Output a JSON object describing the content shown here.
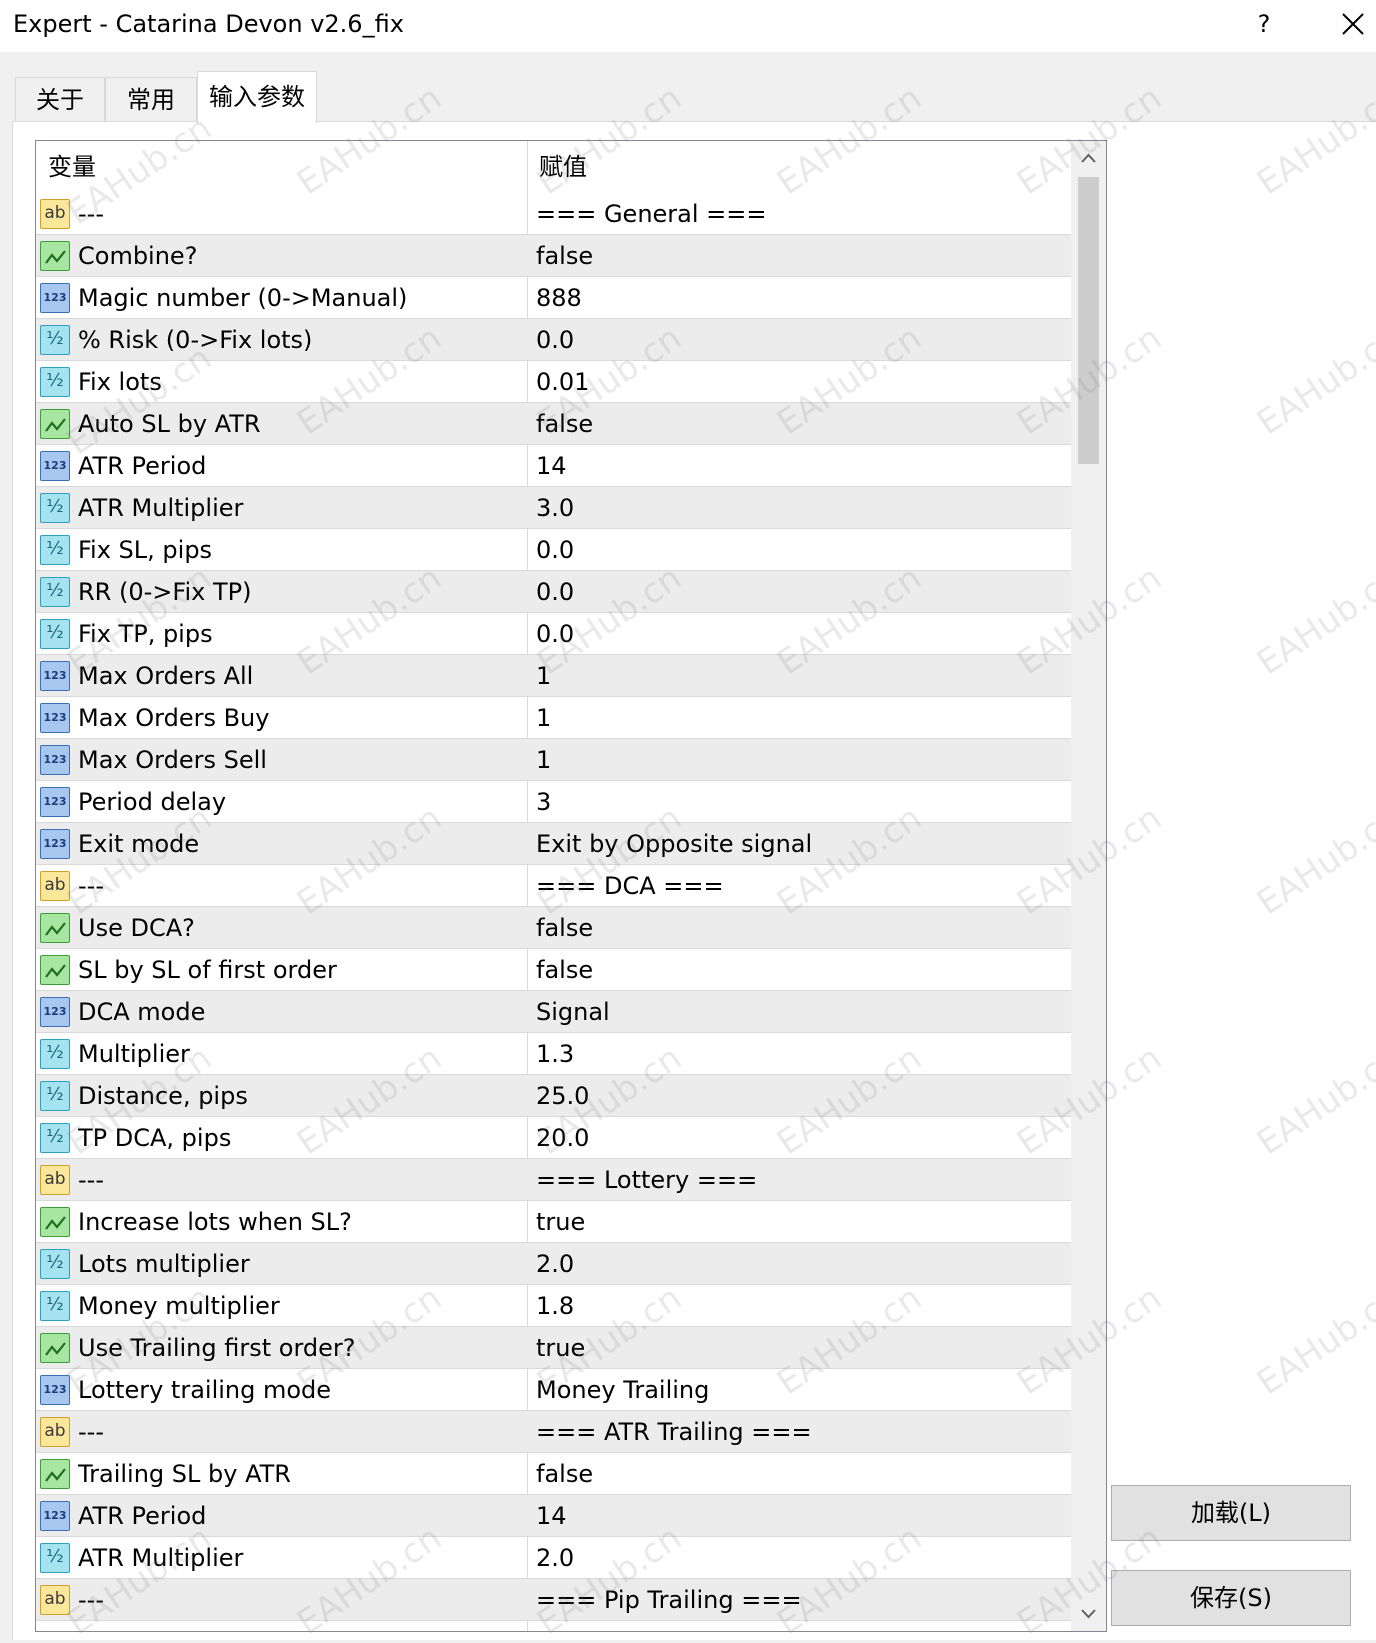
{
  "window": {
    "title": "Expert - Catarina Devon v2.6_fix",
    "help_label": "?"
  },
  "tabs": [
    {
      "label": "关于"
    },
    {
      "label": "常用"
    },
    {
      "label": "输入参数"
    }
  ],
  "grid": {
    "col_variable": "变量",
    "col_value": "赋值",
    "rows": [
      {
        "type": "string",
        "name": "---",
        "value": "=== General ==="
      },
      {
        "type": "bool",
        "name": "Combine?",
        "value": "false"
      },
      {
        "type": "int",
        "name": "Magic number (0->Manual)",
        "value": "888"
      },
      {
        "type": "double",
        "name": "% Risk (0->Fix lots)",
        "value": "0.0"
      },
      {
        "type": "double",
        "name": "Fix lots",
        "value": "0.01"
      },
      {
        "type": "bool",
        "name": "Auto SL by ATR",
        "value": "false"
      },
      {
        "type": "int",
        "name": "ATR Period",
        "value": "14"
      },
      {
        "type": "double",
        "name": "ATR Multiplier",
        "value": "3.0"
      },
      {
        "type": "double",
        "name": "Fix SL, pips",
        "value": "0.0"
      },
      {
        "type": "double",
        "name": "RR (0->Fix TP)",
        "value": "0.0"
      },
      {
        "type": "double",
        "name": "Fix TP, pips",
        "value": "0.0"
      },
      {
        "type": "int",
        "name": "Max Orders All",
        "value": "1"
      },
      {
        "type": "int",
        "name": "Max Orders Buy",
        "value": "1"
      },
      {
        "type": "int",
        "name": "Max Orders Sell",
        "value": "1"
      },
      {
        "type": "int",
        "name": "Period delay",
        "value": "3"
      },
      {
        "type": "int",
        "name": "Exit mode",
        "value": "Exit by Opposite signal"
      },
      {
        "type": "string",
        "name": "---",
        "value": "=== DCA ==="
      },
      {
        "type": "bool",
        "name": "Use DCA?",
        "value": "false"
      },
      {
        "type": "bool",
        "name": "SL by SL of first order",
        "value": "false"
      },
      {
        "type": "int",
        "name": "DCA mode",
        "value": "Signal"
      },
      {
        "type": "double",
        "name": "Multiplier",
        "value": "1.3"
      },
      {
        "type": "double",
        "name": "Distance, pips",
        "value": "25.0"
      },
      {
        "type": "double",
        "name": "TP DCA, pips",
        "value": "20.0"
      },
      {
        "type": "string",
        "name": "---",
        "value": "=== Lottery ==="
      },
      {
        "type": "bool",
        "name": "Increase lots when SL?",
        "value": "true"
      },
      {
        "type": "double",
        "name": "Lots multiplier",
        "value": "2.0"
      },
      {
        "type": "double",
        "name": "Money multiplier",
        "value": "1.8"
      },
      {
        "type": "bool",
        "name": "Use Trailing first order?",
        "value": "true"
      },
      {
        "type": "int",
        "name": "Lottery trailing mode",
        "value": "Money Trailing"
      },
      {
        "type": "string",
        "name": "---",
        "value": "=== ATR Trailing ==="
      },
      {
        "type": "bool",
        "name": "Trailing SL by ATR",
        "value": "false"
      },
      {
        "type": "int",
        "name": "ATR Period",
        "value": "14"
      },
      {
        "type": "double",
        "name": "ATR Multiplier",
        "value": "2.0"
      },
      {
        "type": "string",
        "name": "---",
        "value": "=== Pip Trailing ==="
      }
    ]
  },
  "buttons": {
    "load": "加载(L)",
    "save": "保存(S)"
  },
  "watermark_text": "EAHub.cn"
}
